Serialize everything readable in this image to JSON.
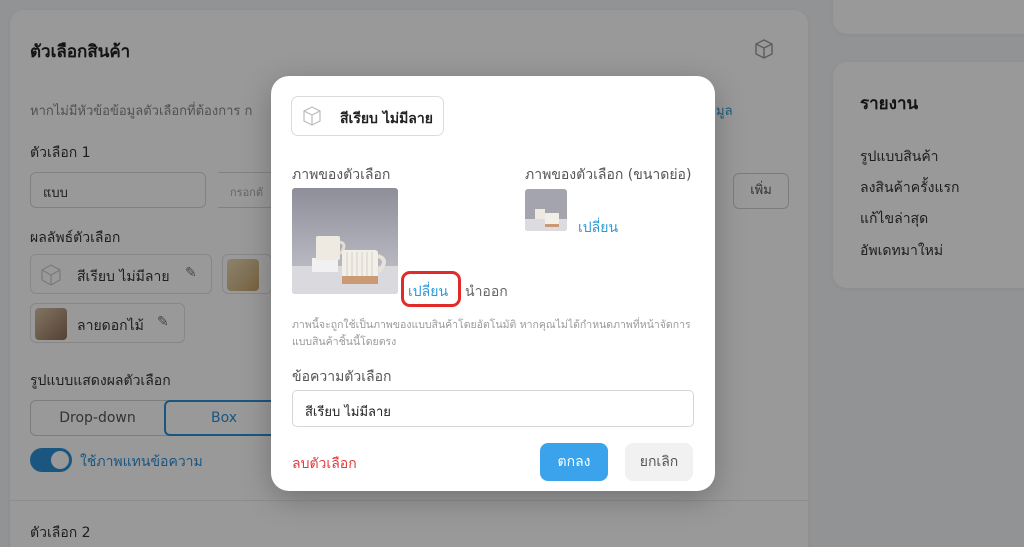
{
  "background": {
    "card_title": "ตัวเลือกสินค้า",
    "hint_text": "หากไม่มีหัวข้อข้อมูลตัวเลือกที่ต้องการ ก",
    "hint_link": "มูล",
    "option1_label": "ตัวเลือก 1",
    "option_type_select": "แบบ",
    "option_input_placeholder": "กรอกตั",
    "add_button": "เพิ่ม",
    "option_results_label": "ผลลัพธ์ตัวเลือก",
    "chips": [
      {
        "label": "สีเรียบ ไม่มีลาย"
      },
      {
        "label": "ลายดอกไม้"
      }
    ],
    "display_style_label": "รูปแบบแสดงผลตัวเลือก",
    "display_options": [
      "Drop-down",
      "Box"
    ],
    "selected_display": "Box",
    "toggle_label": "ใช้ภาพแทนข้อความ",
    "option2_label": "ตัวเลือก 2",
    "report": {
      "title": "รายงาน",
      "items": [
        "รูปแบบสินค้า",
        "ลงสินค้าครั้งแรก",
        "แก้ไขล่าสุด",
        "อัพเดทมาใหม่"
      ]
    }
  },
  "modal": {
    "chip_label": "สีเรียบ ไม่มีลาย",
    "image_label": "ภาพของตัวเลือก",
    "thumb_label": "ภาพของตัวเลือก (ขนาดย่อ)",
    "change_link": "เปลี่ยน",
    "thumb_change_link": "เปลี่ยน",
    "remove_link": "นำออก",
    "note": "ภาพนี้จะถูกใช้เป็นภาพของแบบสินค้าโดยอัตโนมัติ หากคุณไม่ได้กำหนดภาพที่หน้าจัดการแบบสินค้าชิ้นนี้โดยตรง",
    "text_label": "ข้อความตัวเลือก",
    "text_value": "สีเรียบ ไม่มีลาย",
    "delete_link": "ลบตัวเลือก",
    "ok_button": "ตกลง",
    "cancel_button": "ยกเลิก"
  },
  "colors": {
    "accent": "#2c8fd6",
    "link": "#2c9ad8",
    "primary_button": "#3aa3ec",
    "danger": "#e03a3a",
    "highlight_box": "#e02b2b"
  }
}
